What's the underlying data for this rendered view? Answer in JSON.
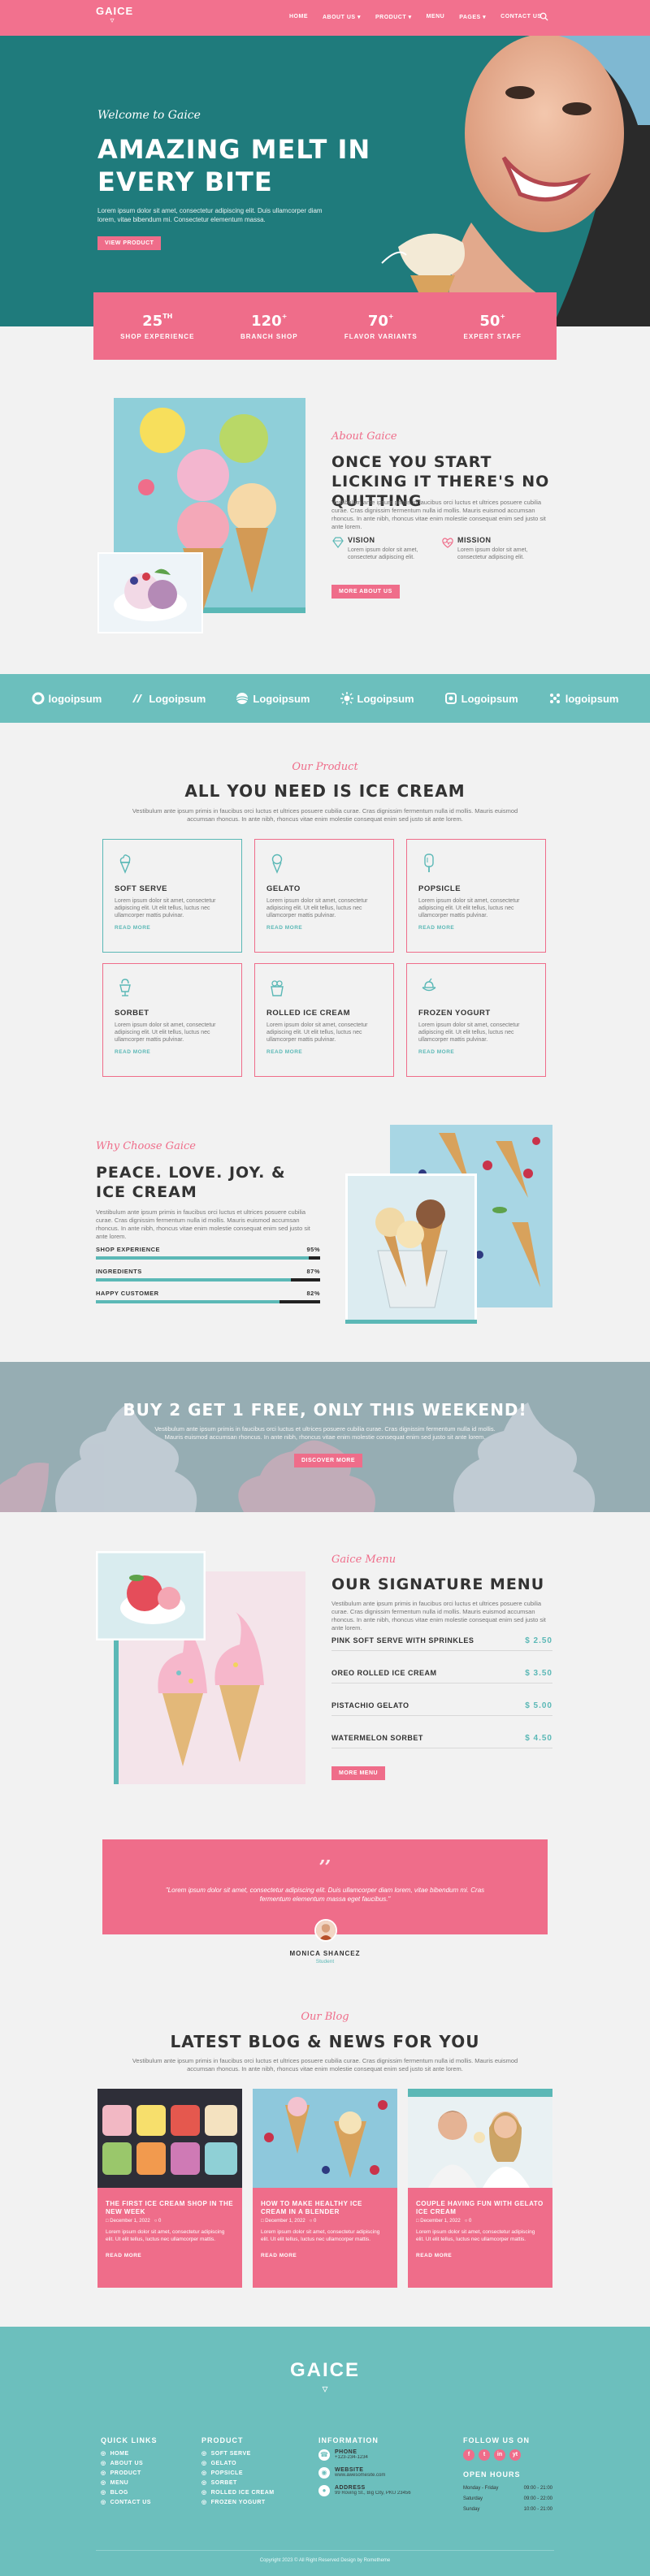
{
  "nav": {
    "logo": "GAICE",
    "items": [
      "HOME",
      "ABOUT US ▾",
      "PRODUCT ▾",
      "MENU",
      "PAGES ▾",
      "CONTACT US"
    ]
  },
  "hero": {
    "welcome": "Welcome to Gaice",
    "title": "AMAZING MELT IN EVERY BITE",
    "text": "Lorem ipsum dolor sit amet, consectetur adipiscing elit. Duis ullamcorper diam lorem, vitae bibendum mi. Consectetur elementum massa.",
    "button": "VIEW PRODUCT"
  },
  "stats": [
    {
      "num": "25",
      "sup": "TH",
      "label": "SHOP EXPERIENCE"
    },
    {
      "num": "120",
      "sup": "+",
      "label": "BRANCH SHOP"
    },
    {
      "num": "70",
      "sup": "+",
      "label": "FLAVOR VARIANTS"
    },
    {
      "num": "50",
      "sup": "+",
      "label": "EXPERT STAFF"
    }
  ],
  "about": {
    "script": "About Gaice",
    "title": "ONCE YOU START LICKING IT THERE'S NO QUITTING",
    "text": "Vestibulum ante ipsum primis in faucibus orci luctus et ultrices posuere cubilia curae. Cras dignissim fermentum nulla id mollis. Mauris euismod accumsan rhoncus. In ante nibh, rhoncus vitae enim molestie consequat enim sed justo sit ante lorem.",
    "vision_title": "VISION",
    "vision_text": "Lorem ipsum dolor sit amet, consectetur adipiscing elit.",
    "mission_title": "MISSION",
    "mission_text": "Lorem ipsum dolor sit amet, consectetur adipiscing elit.",
    "button": "MORE ABOUT US"
  },
  "logos": [
    "logoipsum",
    "Logoipsum",
    "Logoipsum",
    "Logoipsum",
    "Logoipsum",
    "logoipsum"
  ],
  "products": {
    "script": "Our Product",
    "title": "ALL YOU NEED IS ICE CREAM",
    "text": "Vestibulum ante ipsum primis in faucibus orci luctus et ultrices posuere cubilia curae. Cras dignissim fermentum nulla id mollis. Mauris euismod accumsan rhoncus. In ante nibh, rhoncus vitae enim molestie consequat enim sed justo sit ante lorem.",
    "items": [
      {
        "title": "SOFT SERVE",
        "text": "Lorem ipsum dolor sit amet, consectetur adipiscing elit. Ut elit tellus, luctus nec ullamcorper mattis pulvinar.",
        "link": "READ MORE",
        "icon": "soft-serve-icon"
      },
      {
        "title": "GELATO",
        "text": "Lorem ipsum dolor sit amet, consectetur adipiscing elit. Ut elit tellus, luctus nec ullamcorper mattis pulvinar.",
        "link": "READ MORE",
        "icon": "gelato-icon"
      },
      {
        "title": "POPSICLE",
        "text": "Lorem ipsum dolor sit amet, consectetur adipiscing elit. Ut elit tellus, luctus nec ullamcorper mattis pulvinar.",
        "link": "READ MORE",
        "icon": "popsicle-icon"
      },
      {
        "title": "SORBET",
        "text": "Lorem ipsum dolor sit amet, consectetur adipiscing elit. Ut elit tellus, luctus nec ullamcorper mattis pulvinar.",
        "link": "READ MORE",
        "icon": "sorbet-icon"
      },
      {
        "title": "ROLLED ICE CREAM",
        "text": "Lorem ipsum dolor sit amet, consectetur adipiscing elit. Ut elit tellus, luctus nec ullamcorper mattis pulvinar.",
        "link": "READ MORE",
        "icon": "rolled-ice-cream-icon"
      },
      {
        "title": "FROZEN YOGURT",
        "text": "Lorem ipsum dolor sit amet, consectetur adipiscing elit. Ut elit tellus, luctus nec ullamcorper mattis pulvinar.",
        "link": "READ MORE",
        "icon": "frozen-yogurt-icon"
      }
    ]
  },
  "why": {
    "script": "Why Choose Gaice",
    "title": "PEACE. LOVE. JOY. & ICE CREAM",
    "text": "Vestibulum ante ipsum primis in faucibus orci luctus et ultrices posuere cubilia curae. Cras dignissim fermentum nulla id mollis. Mauris euismod accumsan rhoncus. In ante nibh, rhoncus vitae enim molestie consequat enim sed justo sit ante lorem.",
    "bars": [
      {
        "label": "SHOP EXPERIENCE",
        "pct": "95%",
        "value": 0.95
      },
      {
        "label": "INGREDIENTS",
        "pct": "87%",
        "value": 0.87
      },
      {
        "label": "HAPPY CUSTOMER",
        "pct": "82%",
        "value": 0.82
      }
    ]
  },
  "promo": {
    "title": "BUY 2 GET 1 FREE, ONLY THIS WEEKEND!",
    "text": "Vestibulum ante ipsum primis in faucibus orci luctus et ultrices posuere cubilia curae. Cras dignissim fermentum nulla id mollis. Mauris euismod accumsan rhoncus. In ante nibh, rhoncus vitae enim molestie consequat enim sed justo sit ante lorem.",
    "button": "DISCOVER MORE"
  },
  "menu": {
    "script": "Gaice Menu",
    "title": "OUR SIGNATURE MENU",
    "text": "Vestibulum ante ipsum primis in faucibus orci luctus et ultrices posuere cubilia curae. Cras dignissim fermentum nulla id mollis. Mauris euismod accumsan rhoncus. In ante nibh, rhoncus vitae enim molestie consequat enim sed justo sit ante lorem.",
    "items": [
      {
        "name": "PINK SOFT SERVE WITH SPRINKLES",
        "price": "$ 2.50"
      },
      {
        "name": "OREO ROLLED ICE CREAM",
        "price": "$ 3.50"
      },
      {
        "name": "PISTACHIO GELATO",
        "price": "$ 5.00"
      },
      {
        "name": "WATERMELON SORBET",
        "price": "$ 4.50"
      }
    ],
    "button": "MORE MENU"
  },
  "testimonial": {
    "text": "\"Lorem ipsum dolor sit amet, consectetur adipiscing elit. Duis ullamcorper diam lorem, vitae bibendum mi. Cras fermentum elementum massa eget faucibus.\"",
    "name": "MONICA SHANCEZ",
    "role": "Student"
  },
  "blog": {
    "script": "Our Blog",
    "title": "LATEST BLOG & NEWS FOR YOU",
    "text": "Vestibulum ante ipsum primis in faucibus orci luctus et ultrices posuere cubilia curae. Cras dignissim fermentum nulla id mollis. Mauris euismod accumsan rhoncus. In ante nibh, rhoncus vitae enim molestie consequat enim sed justo sit ante lorem.",
    "posts": [
      {
        "title": "THE FIRST ICE CREAM SHOP IN THE NEW WEEK",
        "date": "December 1, 2022",
        "comments": "0",
        "text": "Lorem ipsum dolor sit amet, consectetur adipiscing elit. Ut elit tellus, luctus nec ullamcorper mattis.",
        "link": "READ MORE"
      },
      {
        "title": "HOW TO MAKE HEALTHY ICE CREAM IN A BLENDER",
        "date": "December 1, 2022",
        "comments": "0",
        "text": "Lorem ipsum dolor sit amet, consectetur adipiscing elit. Ut elit tellus, luctus nec ullamcorper mattis.",
        "link": "READ MORE"
      },
      {
        "title": "COUPLE HAVING FUN WITH GELATO ICE CREAM",
        "date": "December 1, 2022",
        "comments": "0",
        "text": "Lorem ipsum dolor sit amet, consectetur adipiscing elit. Ut elit tellus, luctus nec ullamcorper mattis.",
        "link": "READ MORE"
      }
    ]
  },
  "footer": {
    "logo": "GAICE",
    "quick_links_title": "QUICK LINKS",
    "quick_links": [
      "HOME",
      "ABOUT US",
      "PRODUCT",
      "MENU",
      "BLOG",
      "CONTACT US"
    ],
    "product_title": "PRODUCT",
    "products": [
      "SOFT SERVE",
      "GELATO",
      "POPSICLE",
      "SORBET",
      "ROLLED ICE CREAM",
      "FROZEN YOGURT"
    ],
    "info_title": "INFORMATION",
    "phone_label": "PHONE",
    "phone": "+123-234-1234",
    "website_label": "WEBSITE",
    "website": "www.awesomesite.com",
    "address_label": "ADDRESS",
    "address": "99 Roving St., Big City, PKU 23456",
    "follow_title": "FOLLOW US ON",
    "social": [
      "f",
      "t",
      "in",
      "yt"
    ],
    "hours_title": "OPEN HOURS",
    "hours": [
      {
        "day": "Monday - Friday",
        "time": "09:00 - 21:00"
      },
      {
        "day": "Saturday",
        "time": "09:00 - 22:00"
      },
      {
        "day": "Sunday",
        "time": "10:00 - 21:00"
      }
    ],
    "copyright": "Copyright 2023 © All Right Reserved Design by Rometheme"
  },
  "colors": {
    "pink": "#ef6d8a",
    "teal": "#5bb8b6",
    "dark_teal": "#1f7b7c"
  }
}
